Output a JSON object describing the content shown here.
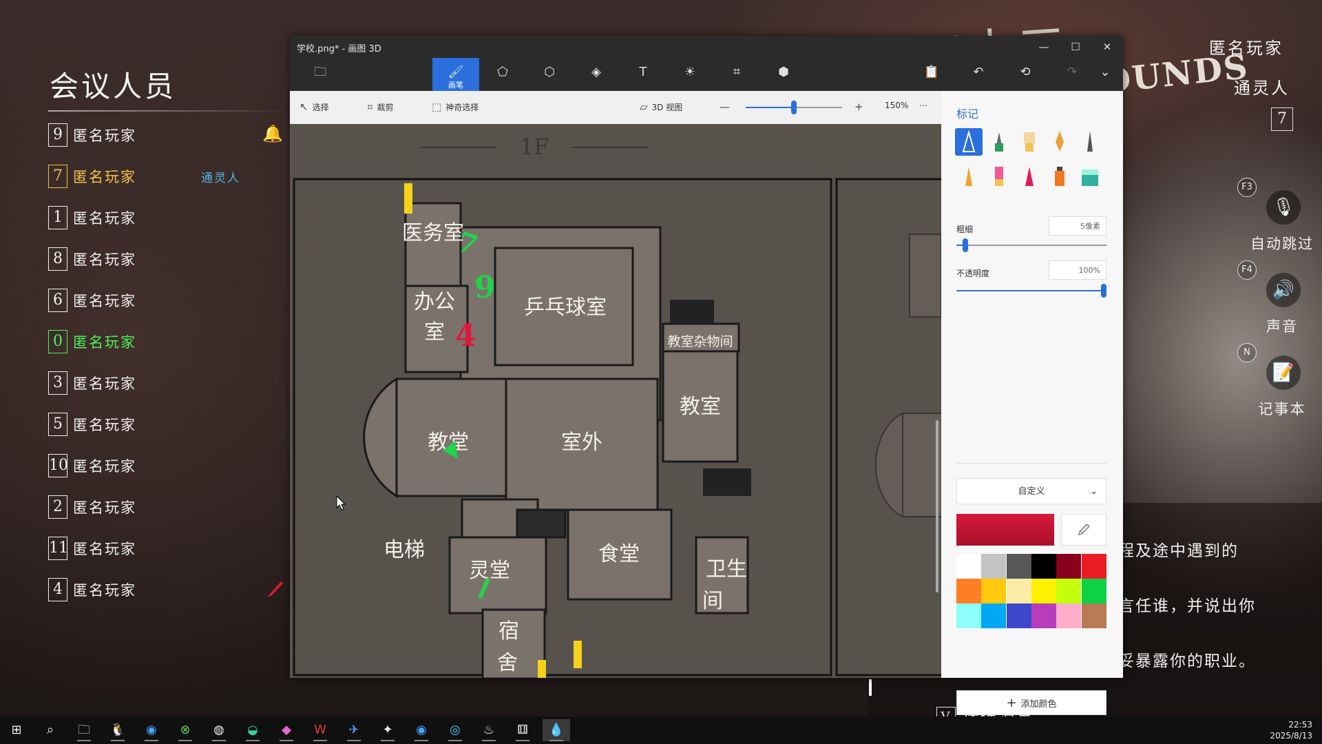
{
  "game": {
    "brand_cn": "三十三",
    "brand_en": "OUNDS",
    "roster": {
      "title": "会议人员",
      "players": [
        {
          "num": "9",
          "name": "匿名玩家",
          "name_color": "#f0f0f0",
          "role": ""
        },
        {
          "num": "7",
          "name": "匿名玩家",
          "name_color": "#f2c14e",
          "role": "通灵人"
        },
        {
          "num": "1",
          "name": "匿名玩家",
          "name_color": "#f0f0f0",
          "role": ""
        },
        {
          "num": "8",
          "name": "匿名玩家",
          "name_color": "#f0f0f0",
          "role": ""
        },
        {
          "num": "6",
          "name": "匿名玩家",
          "name_color": "#f0f0f0",
          "role": ""
        },
        {
          "num": "0",
          "name": "匿名玩家",
          "name_color": "#4ff05a",
          "role": ""
        },
        {
          "num": "3",
          "name": "匿名玩家",
          "name_color": "#f0f0f0",
          "role": ""
        },
        {
          "num": "5",
          "name": "匿名玩家",
          "name_color": "#f0f0f0",
          "role": ""
        },
        {
          "num": "10",
          "name": "匿名玩家",
          "name_color": "#f0f0f0",
          "role": ""
        },
        {
          "num": "2",
          "name": "匿名玩家",
          "name_color": "#f0f0f0",
          "role": ""
        },
        {
          "num": "11",
          "name": "匿名玩家",
          "name_color": "#f0f0f0",
          "role": ""
        },
        {
          "num": "4",
          "name": "匿名玩家",
          "name_color": "#f0f0f0",
          "role": ""
        }
      ]
    },
    "self": {
      "name": "匿名玩家",
      "role": "通灵人",
      "num": "7"
    },
    "side_buttons": [
      {
        "key": "F3",
        "icon": "mic-muted-icon",
        "label": "自动跳过"
      },
      {
        "key": "F4",
        "icon": "speaker-icon",
        "label": "声音"
      },
      {
        "key": "N",
        "icon": "notepad-icon",
        "label": "记事本"
      }
    ],
    "chat_lines": [
      "程及途中遇到的",
      "言任谁，并说出你",
      "妥暴露你的职业。"
    ],
    "quick_key": "V",
    "quick_label": "快捷消息"
  },
  "paint": {
    "title": "学校.png* - 画图 3D",
    "ribbon": {
      "brush_label": "画笔"
    },
    "toolbar": {
      "select": "选择",
      "crop": "裁剪",
      "magic_select": "神奇选择",
      "view3d": "3D 视图",
      "zoom": "150%",
      "zoom_fraction": 0.5
    },
    "panel": {
      "title": "标记",
      "thickness_label": "粗细",
      "thickness_value": "5像素",
      "thickness_fraction": 0.06,
      "opacity_label": "不透明度",
      "opacity_value": "100%",
      "opacity_fraction": 1.0,
      "dropdown": "自定义",
      "current_color": "#d8183a",
      "add_color": "添加颜色",
      "palette": [
        "#ffffff",
        "#c3c3c3",
        "#585858",
        "#000000",
        "#88001b",
        "#ec1c24",
        "#ff7f27",
        "#ffc90e",
        "#fdeca6",
        "#fff200",
        "#c4ff0e",
        "#0ed145",
        "#8cfffb",
        "#00a8f3",
        "#3f48cc",
        "#b83dba",
        "#ffaec9",
        "#b97a56"
      ]
    },
    "map": {
      "floor": "1F",
      "rooms": {
        "infirmary": "医务室",
        "office_a": "办公",
        "office_b": "室",
        "pingpong": "乒乓球室",
        "storage": "教室杂物间",
        "classroom": "教室",
        "church": "教堂",
        "outdoor": "室外",
        "elevator": "电梯",
        "spirit": "灵堂",
        "canteen": "食堂",
        "toilet_a": "卫生",
        "toilet_b": "间",
        "dorm_a": "宿",
        "dorm_b": "舍"
      },
      "annotations": {
        "green_num": "9",
        "red_num": "4",
        "green_seven": "7"
      }
    }
  },
  "taskbar": {
    "time": "22:53",
    "date": "2025/8/13",
    "apps": [
      "start-icon",
      "search-icon",
      "explorer-icon",
      "qq-icon",
      "browser-icon",
      "xbox-icon",
      "steam-client-icon",
      "edge-icon",
      "m365-icon",
      "wps-icon",
      "feishu-icon",
      "game-app-icon",
      "search-app-icon",
      "qiyu-icon",
      "steam-icon",
      "game-icon",
      "paint3d-icon"
    ]
  }
}
